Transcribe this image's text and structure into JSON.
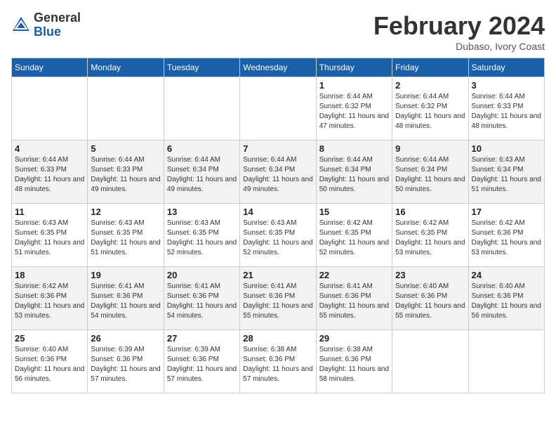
{
  "header": {
    "logo_general": "General",
    "logo_blue": "Blue",
    "month_title": "February 2024",
    "subtitle": "Dubaso, Ivory Coast"
  },
  "days_of_week": [
    "Sunday",
    "Monday",
    "Tuesday",
    "Wednesday",
    "Thursday",
    "Friday",
    "Saturday"
  ],
  "weeks": [
    [
      {
        "day": "",
        "info": ""
      },
      {
        "day": "",
        "info": ""
      },
      {
        "day": "",
        "info": ""
      },
      {
        "day": "",
        "info": ""
      },
      {
        "day": "1",
        "info": "Sunrise: 6:44 AM\nSunset: 6:32 PM\nDaylight: 11 hours and 47 minutes."
      },
      {
        "day": "2",
        "info": "Sunrise: 6:44 AM\nSunset: 6:32 PM\nDaylight: 11 hours and 48 minutes."
      },
      {
        "day": "3",
        "info": "Sunrise: 6:44 AM\nSunset: 6:33 PM\nDaylight: 11 hours and 48 minutes."
      }
    ],
    [
      {
        "day": "4",
        "info": "Sunrise: 6:44 AM\nSunset: 6:33 PM\nDaylight: 11 hours and 48 minutes."
      },
      {
        "day": "5",
        "info": "Sunrise: 6:44 AM\nSunset: 6:33 PM\nDaylight: 11 hours and 49 minutes."
      },
      {
        "day": "6",
        "info": "Sunrise: 6:44 AM\nSunset: 6:34 PM\nDaylight: 11 hours and 49 minutes."
      },
      {
        "day": "7",
        "info": "Sunrise: 6:44 AM\nSunset: 6:34 PM\nDaylight: 11 hours and 49 minutes."
      },
      {
        "day": "8",
        "info": "Sunrise: 6:44 AM\nSunset: 6:34 PM\nDaylight: 11 hours and 50 minutes."
      },
      {
        "day": "9",
        "info": "Sunrise: 6:44 AM\nSunset: 6:34 PM\nDaylight: 11 hours and 50 minutes."
      },
      {
        "day": "10",
        "info": "Sunrise: 6:43 AM\nSunset: 6:34 PM\nDaylight: 11 hours and 51 minutes."
      }
    ],
    [
      {
        "day": "11",
        "info": "Sunrise: 6:43 AM\nSunset: 6:35 PM\nDaylight: 11 hours and 51 minutes."
      },
      {
        "day": "12",
        "info": "Sunrise: 6:43 AM\nSunset: 6:35 PM\nDaylight: 11 hours and 51 minutes."
      },
      {
        "day": "13",
        "info": "Sunrise: 6:43 AM\nSunset: 6:35 PM\nDaylight: 11 hours and 52 minutes."
      },
      {
        "day": "14",
        "info": "Sunrise: 6:43 AM\nSunset: 6:35 PM\nDaylight: 11 hours and 52 minutes."
      },
      {
        "day": "15",
        "info": "Sunrise: 6:42 AM\nSunset: 6:35 PM\nDaylight: 11 hours and 52 minutes."
      },
      {
        "day": "16",
        "info": "Sunrise: 6:42 AM\nSunset: 6:35 PM\nDaylight: 11 hours and 53 minutes."
      },
      {
        "day": "17",
        "info": "Sunrise: 6:42 AM\nSunset: 6:36 PM\nDaylight: 11 hours and 53 minutes."
      }
    ],
    [
      {
        "day": "18",
        "info": "Sunrise: 6:42 AM\nSunset: 6:36 PM\nDaylight: 11 hours and 53 minutes."
      },
      {
        "day": "19",
        "info": "Sunrise: 6:41 AM\nSunset: 6:36 PM\nDaylight: 11 hours and 54 minutes."
      },
      {
        "day": "20",
        "info": "Sunrise: 6:41 AM\nSunset: 6:36 PM\nDaylight: 11 hours and 54 minutes."
      },
      {
        "day": "21",
        "info": "Sunrise: 6:41 AM\nSunset: 6:36 PM\nDaylight: 11 hours and 55 minutes."
      },
      {
        "day": "22",
        "info": "Sunrise: 6:41 AM\nSunset: 6:36 PM\nDaylight: 11 hours and 55 minutes."
      },
      {
        "day": "23",
        "info": "Sunrise: 6:40 AM\nSunset: 6:36 PM\nDaylight: 11 hours and 55 minutes."
      },
      {
        "day": "24",
        "info": "Sunrise: 6:40 AM\nSunset: 6:36 PM\nDaylight: 11 hours and 56 minutes."
      }
    ],
    [
      {
        "day": "25",
        "info": "Sunrise: 6:40 AM\nSunset: 6:36 PM\nDaylight: 11 hours and 56 minutes."
      },
      {
        "day": "26",
        "info": "Sunrise: 6:39 AM\nSunset: 6:36 PM\nDaylight: 11 hours and 57 minutes."
      },
      {
        "day": "27",
        "info": "Sunrise: 6:39 AM\nSunset: 6:36 PM\nDaylight: 11 hours and 57 minutes."
      },
      {
        "day": "28",
        "info": "Sunrise: 6:38 AM\nSunset: 6:36 PM\nDaylight: 11 hours and 57 minutes."
      },
      {
        "day": "29",
        "info": "Sunrise: 6:38 AM\nSunset: 6:36 PM\nDaylight: 11 hours and 58 minutes."
      },
      {
        "day": "",
        "info": ""
      },
      {
        "day": "",
        "info": ""
      }
    ]
  ]
}
